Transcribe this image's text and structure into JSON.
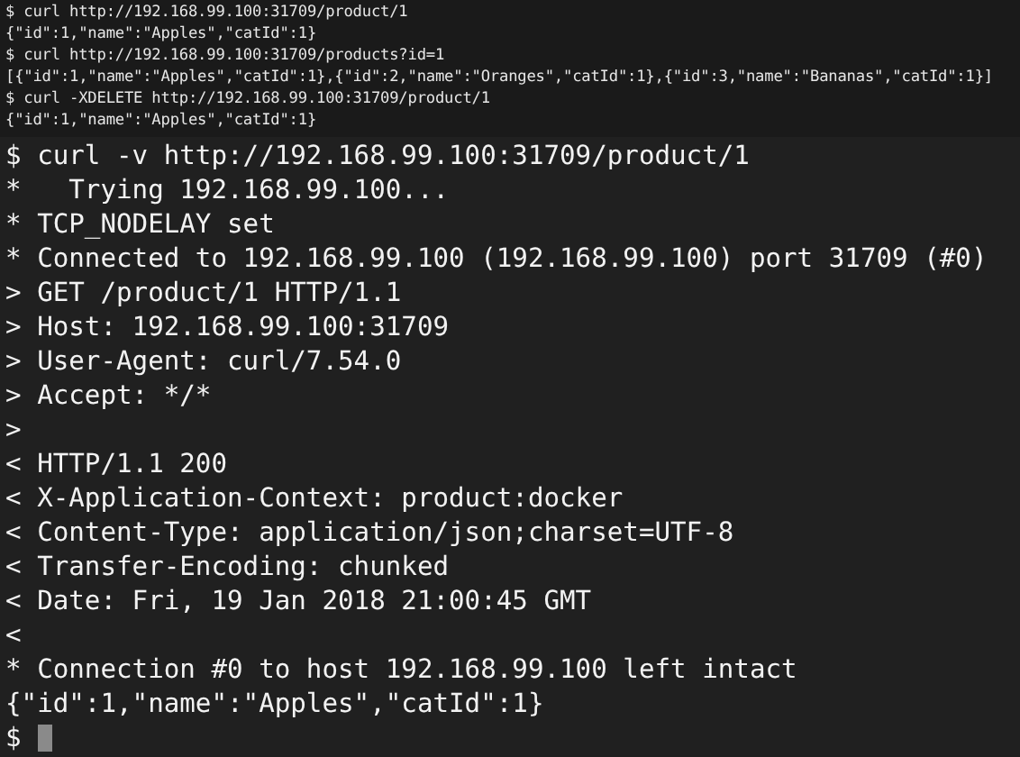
{
  "earlier_output": [
    "$ curl http://192.168.99.100:31709/product/1",
    "{\"id\":1,\"name\":\"Apples\",\"catId\":1}",
    "$ curl http://192.168.99.100:31709/products?id=1",
    "[{\"id\":1,\"name\":\"Apples\",\"catId\":1},{\"id\":2,\"name\":\"Oranges\",\"catId\":1},{\"id\":3,\"name\":\"Bananas\",\"catId\":1}]",
    "$ curl -XDELETE http://192.168.99.100:31709/product/1",
    "{\"id\":1,\"name\":\"Apples\",\"catId\":1}"
  ],
  "terminal_lines": [
    "$ curl -v http://192.168.99.100:31709/product/1",
    "*   Trying 192.168.99.100...",
    "* TCP_NODELAY set",
    "* Connected to 192.168.99.100 (192.168.99.100) port 31709 (#0)",
    "> GET /product/1 HTTP/1.1",
    "> Host: 192.168.99.100:31709",
    "> User-Agent: curl/7.54.0",
    "> Accept: */*",
    ">",
    "< HTTP/1.1 200",
    "< X-Application-Context: product:docker",
    "< Content-Type: application/json;charset=UTF-8",
    "< Transfer-Encoding: chunked",
    "< Date: Fri, 19 Jan 2018 21:00:45 GMT",
    "<",
    "* Connection #0 to host 192.168.99.100 left intact",
    "{\"id\":1,\"name\":\"Apples\",\"catId\":1}"
  ],
  "prompt": {
    "text": "$",
    "cursor": true
  }
}
